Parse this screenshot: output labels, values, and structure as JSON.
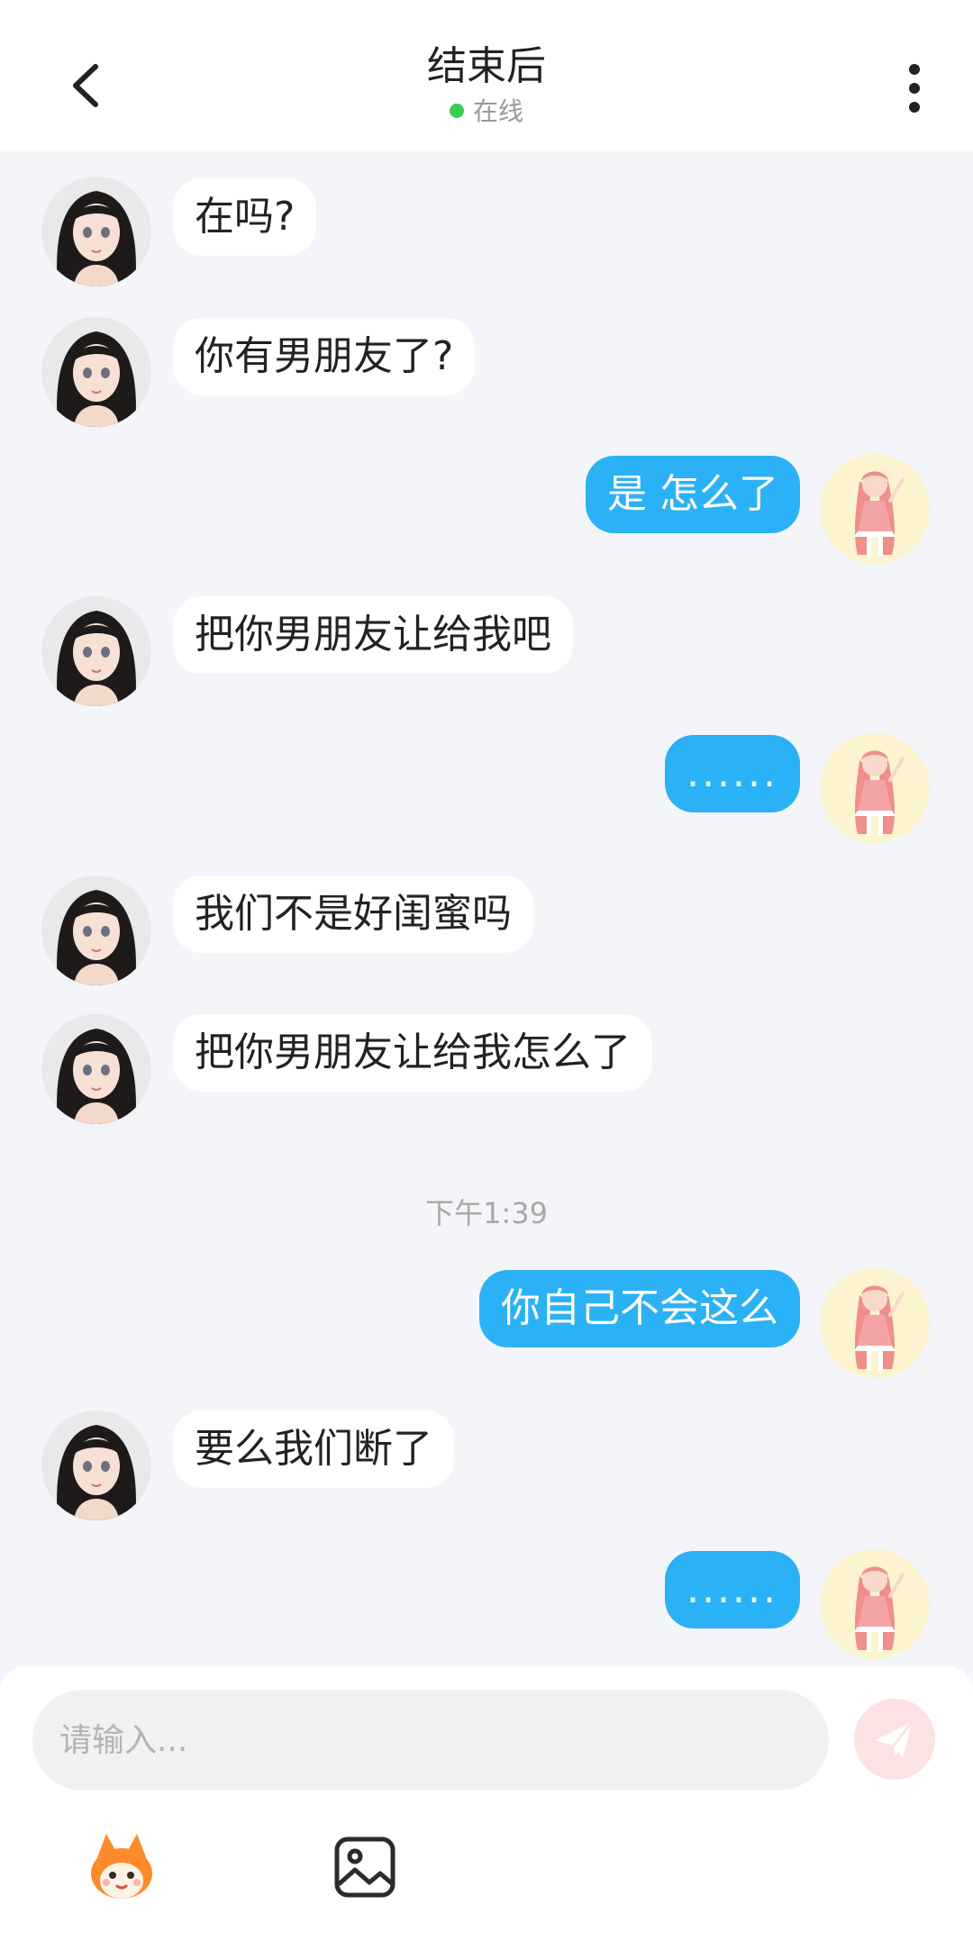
{
  "header": {
    "title": "结束后",
    "status": "在线"
  },
  "composer": {
    "placeholder": "请输入..."
  },
  "icons": {
    "back": "chevron-left-icon",
    "more": "more-vertical-icon",
    "send": "paper-plane-icon",
    "sticker": "fox-mascot-icon",
    "image": "image-icon"
  },
  "colors": {
    "outgoing_bubble": "#2bb1f5",
    "incoming_bubble": "#ffffff",
    "online": "#3ccc52",
    "send_button": "#fde2e3"
  },
  "messages": [
    {
      "from": "other",
      "text": "在吗?"
    },
    {
      "from": "other",
      "text": "你有男朋友了?"
    },
    {
      "from": "me",
      "text": "是  怎么了"
    },
    {
      "from": "other",
      "text": "把你男朋友让给我吧"
    },
    {
      "from": "me",
      "text": "......"
    },
    {
      "from": "other",
      "text": "我们不是好闺蜜吗"
    },
    {
      "from": "other",
      "text": "把你男朋友让给我怎么了"
    },
    {
      "type": "time",
      "text": "下午1:39"
    },
    {
      "from": "me",
      "text": "你自己不会这么"
    },
    {
      "from": "other",
      "text": "要么我们断了"
    },
    {
      "from": "me",
      "text": "......"
    }
  ]
}
